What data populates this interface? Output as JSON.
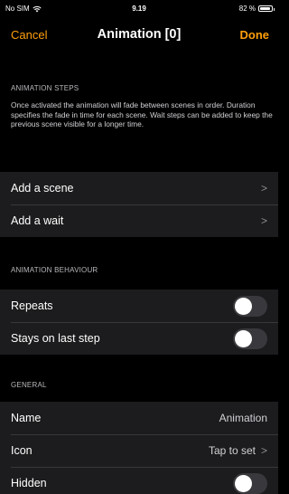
{
  "status": {
    "carrier": "No SIM",
    "time": "9.19",
    "battery": "82 %",
    "battery_level": 0.82
  },
  "nav": {
    "cancel": "Cancel",
    "title": "Animation [0]",
    "done": "Done"
  },
  "animation_steps": {
    "header": "ANIMATION STEPS",
    "description": "Once activated the animation will fade between scenes in order. Duration specifies the fade in time for each scene. Wait steps can be added to keep the previous scene visible for a longer time.",
    "rows": [
      {
        "label": "Add a scene",
        "chevron": ">"
      },
      {
        "label": "Add a wait",
        "chevron": ">"
      }
    ]
  },
  "animation_behaviour": {
    "header": "ANIMATION BEHAVIOUR",
    "rows": [
      {
        "label": "Repeats",
        "on": false
      },
      {
        "label": "Stays on last step",
        "on": false
      }
    ]
  },
  "general": {
    "header": "GENERAL",
    "rows": [
      {
        "label": "Name",
        "value": "Animation"
      },
      {
        "label": "Icon",
        "value": "Tap to set",
        "chevron": ">"
      },
      {
        "label": "Hidden",
        "on": false
      }
    ]
  },
  "colors": {
    "accent": "#ff9f0a",
    "background": "#000000",
    "cell": "#1c1c1e",
    "toggle_off": "#39393d"
  }
}
